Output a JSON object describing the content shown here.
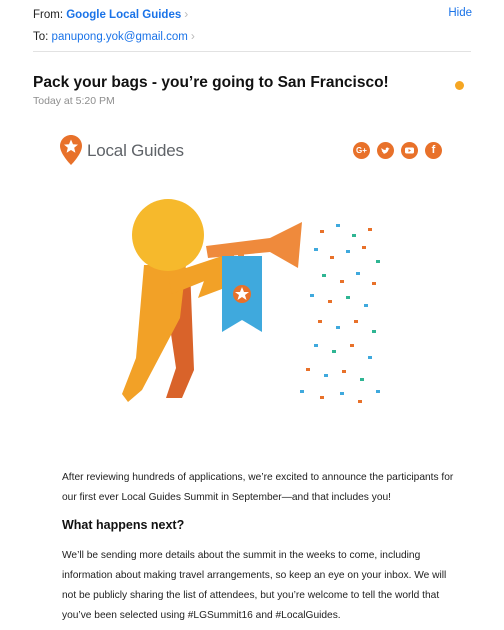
{
  "header": {
    "from_label": "From:",
    "from_name": "Google Local Guides",
    "to_label": "To:",
    "to_address": "panupong.yok@gmail.com",
    "hide_label": "Hide"
  },
  "message": {
    "subject": "Pack your bags - you’re going to San Francisco!",
    "date": "Today at 5:20 PM",
    "unread_color": "#f5a623"
  },
  "email": {
    "brand": "Local Guides",
    "social": [
      "G+",
      "twitter-icon",
      "youtube-icon",
      "f"
    ],
    "accent_color": "#e8712a",
    "paragraph_1": [
      "After reviewing hundreds of applications, we’re excited to announce the participants for",
      "our first ever Local Guides Summit in September—and that includes you!"
    ],
    "heading": "What happens next?",
    "paragraph_2": [
      "We’ll be sending more details about the summit in the weeks to come, including",
      "information about making travel arrangements, so keep an eye on your inbox. We will",
      "not be publicly sharing the list of attendees, but you’re welcome to tell the world that",
      "you’ve been selected using #LGSummit16 and #LocalGuides."
    ]
  }
}
